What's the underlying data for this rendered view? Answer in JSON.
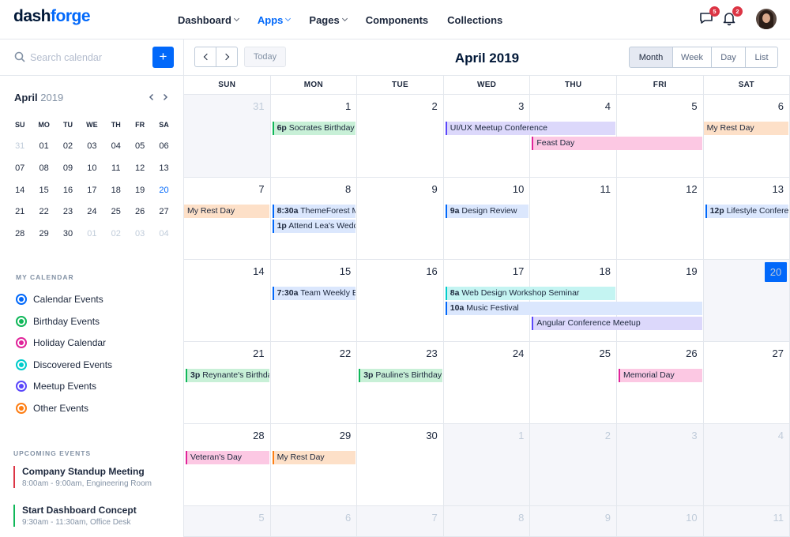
{
  "header": {
    "logo_a": "dash",
    "logo_b": "forge",
    "nav": [
      {
        "label": "Dashboard",
        "dropdown": true,
        "active": false
      },
      {
        "label": "Apps",
        "dropdown": true,
        "active": true
      },
      {
        "label": "Pages",
        "dropdown": true,
        "active": false
      },
      {
        "label": "Components",
        "dropdown": false,
        "active": false
      },
      {
        "label": "Collections",
        "dropdown": false,
        "active": false
      }
    ],
    "messages_badge": "5",
    "notifications_badge": "2"
  },
  "sidebar": {
    "search_placeholder": "Search calendar",
    "add_label": "+",
    "mini_month": "April",
    "mini_year": "2019",
    "mini_weekdays": [
      "SU",
      "MO",
      "TU",
      "WE",
      "TH",
      "FR",
      "SA"
    ],
    "mini_weeks": [
      [
        "31",
        "01",
        "02",
        "03",
        "04",
        "05",
        "06"
      ],
      [
        "07",
        "08",
        "09",
        "10",
        "11",
        "12",
        "13"
      ],
      [
        "14",
        "15",
        "16",
        "17",
        "18",
        "19",
        "20"
      ],
      [
        "21",
        "22",
        "23",
        "24",
        "25",
        "26",
        "27"
      ],
      [
        "28",
        "29",
        "30",
        "01",
        "02",
        "03",
        "04"
      ]
    ],
    "my_calendar_label": "MY CALENDAR",
    "calendars": [
      {
        "label": "Calendar Events",
        "color": "#0168fa"
      },
      {
        "label": "Birthday Events",
        "color": "#10b759"
      },
      {
        "label": "Holiday Calendar",
        "color": "#e0249a"
      },
      {
        "label": "Discovered Events",
        "color": "#00cccc"
      },
      {
        "label": "Meetup Events",
        "color": "#5b47fb"
      },
      {
        "label": "Other Events",
        "color": "#fd7e14"
      }
    ],
    "upcoming_label": "UPCOMING EVENTS",
    "upcoming": [
      {
        "title": "Company Standup Meeting",
        "sub": "8:00am - 9:00am, Engineering Room",
        "color": "#dc3545"
      },
      {
        "title": "Start Dashboard Concept",
        "sub": "9:30am - 11:30am, Office Desk",
        "color": "#10b759"
      }
    ]
  },
  "toolbar": {
    "today_label": "Today",
    "title": "April 2019",
    "views": [
      "Month",
      "Week",
      "Day",
      "List"
    ],
    "active_view": "Month"
  },
  "calendar": {
    "weekdays": [
      "SUN",
      "MON",
      "TUE",
      "WED",
      "THU",
      "FRI",
      "SAT"
    ],
    "weeks": [
      [
        "31",
        "1",
        "2",
        "3",
        "4",
        "5",
        "6"
      ],
      [
        "7",
        "8",
        "9",
        "10",
        "11",
        "12",
        "13"
      ],
      [
        "14",
        "15",
        "16",
        "17",
        "18",
        "19",
        "20"
      ],
      [
        "21",
        "22",
        "23",
        "24",
        "25",
        "26",
        "27"
      ],
      [
        "28",
        "29",
        "30",
        "1",
        "2",
        "3",
        "4"
      ],
      [
        "5",
        "6",
        "7",
        "8",
        "9",
        "10",
        "11"
      ]
    ],
    "today": "20",
    "events": [
      {
        "week": 0,
        "col": 1,
        "span": 1,
        "row": 0,
        "time": "6p",
        "title": "Socrates Birthday",
        "type": "birthday"
      },
      {
        "week": 0,
        "col": 3,
        "span": 2,
        "row": 0,
        "time": "",
        "title": "UI/UX Meetup Conference",
        "type": "meetup"
      },
      {
        "week": 0,
        "col": 4,
        "span": 2,
        "row": 1,
        "time": "",
        "title": "Feast Day",
        "type": "holiday"
      },
      {
        "week": 0,
        "col": 6,
        "span": 1,
        "row": 0,
        "time": "",
        "title": "My Rest Day",
        "type": "other",
        "open_start": true
      },
      {
        "week": 1,
        "col": 0,
        "span": 1,
        "row": 0,
        "time": "",
        "title": "My Rest Day",
        "type": "other",
        "open_start": true
      },
      {
        "week": 1,
        "col": 1,
        "span": 1,
        "row": 0,
        "time": "8:30a",
        "title": "ThemeForest Meetup",
        "type": "calendar"
      },
      {
        "week": 1,
        "col": 1,
        "span": 1,
        "row": 1,
        "time": "1p",
        "title": "Attend Lea's Wedding",
        "type": "calendar"
      },
      {
        "week": 1,
        "col": 3,
        "span": 1,
        "row": 0,
        "time": "9a",
        "title": "Design Review",
        "type": "calendar"
      },
      {
        "week": 1,
        "col": 6,
        "span": 1,
        "row": 0,
        "time": "12p",
        "title": "Lifestyle Conference",
        "type": "calendar"
      },
      {
        "week": 2,
        "col": 1,
        "span": 1,
        "row": 0,
        "time": "7:30a",
        "title": "Team Weekly Brownbag",
        "type": "calendar"
      },
      {
        "week": 2,
        "col": 3,
        "span": 2,
        "row": 0,
        "time": "8a",
        "title": "Web Design Workshop Seminar",
        "type": "discovered"
      },
      {
        "week": 2,
        "col": 3,
        "span": 3,
        "row": 1,
        "time": "10a",
        "title": "Music Festival",
        "type": "calendar"
      },
      {
        "week": 2,
        "col": 4,
        "span": 2,
        "row": 2,
        "time": "",
        "title": "Angular Conference Meetup",
        "type": "meetup"
      },
      {
        "week": 3,
        "col": 0,
        "span": 1,
        "row": 0,
        "time": "3p",
        "title": "Reynante's Birthday",
        "type": "birthday"
      },
      {
        "week": 3,
        "col": 2,
        "span": 1,
        "row": 0,
        "time": "3p",
        "title": "Pauline's Birthday",
        "type": "birthday"
      },
      {
        "week": 3,
        "col": 5,
        "span": 1,
        "row": 0,
        "time": "",
        "title": "Memorial Day",
        "type": "holiday"
      },
      {
        "week": 4,
        "col": 0,
        "span": 1,
        "row": 0,
        "time": "",
        "title": "Veteran's Day",
        "type": "holiday"
      },
      {
        "week": 4,
        "col": 1,
        "span": 1,
        "row": 0,
        "time": "",
        "title": "My Rest Day",
        "type": "other"
      }
    ]
  },
  "colors": {
    "calendar": {
      "bg": "#dbe7fd",
      "border": "#0168fa"
    },
    "birthday": {
      "bg": "#c8f0d7",
      "border": "#10b759"
    },
    "holiday": {
      "bg": "#fcc8e3",
      "border": "#e0249a"
    },
    "discovered": {
      "bg": "#c4f4f2",
      "border": "#00cccc"
    },
    "meetup": {
      "bg": "#dcd8fb",
      "border": "#5b47fb"
    },
    "other": {
      "bg": "#fde0c8",
      "border": "#fd7e14"
    }
  }
}
